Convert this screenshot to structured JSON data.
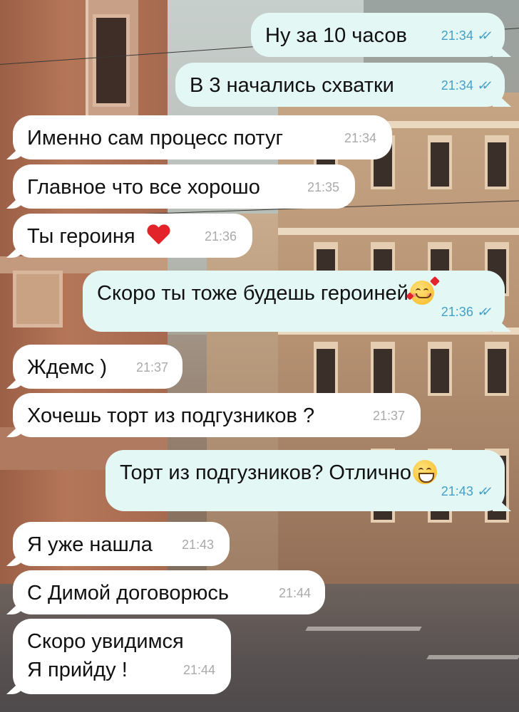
{
  "messages": [
    {
      "dir": "out",
      "text": "Ну за 10 часов",
      "time": "21:34",
      "status": "read"
    },
    {
      "dir": "out",
      "text": "В 3 начались схватки",
      "time": "21:34",
      "status": "read"
    },
    {
      "dir": "in",
      "text": "Именно сам процесс потуг",
      "time": "21:34"
    },
    {
      "dir": "in",
      "text": "Главное что все хорошо",
      "time": "21:35"
    },
    {
      "dir": "in",
      "text": "Ты героиня",
      "time": "21:36",
      "emoji": "red-heart"
    },
    {
      "dir": "out",
      "text": "Скоро ты тоже будешь героиней",
      "time": "21:36",
      "status": "read",
      "emoji": "smiling-face-with-hearts"
    },
    {
      "dir": "in",
      "text": "Ждемс )",
      "time": "21:37"
    },
    {
      "dir": "in",
      "text": "Хочешь торт из подгузников ?",
      "time": "21:37"
    },
    {
      "dir": "out",
      "text": "Торт из подгузников? Отлично",
      "time": "21:43",
      "status": "read",
      "emoji": "grinning-face"
    },
    {
      "dir": "in",
      "text": "Я уже нашла",
      "time": "21:43"
    },
    {
      "dir": "in",
      "text": "С Димой договорюсь",
      "time": "21:44"
    },
    {
      "dir": "in",
      "text": "Скоро увидимся\nЯ прийду !",
      "time": "21:44"
    }
  ],
  "colors": {
    "incoming_bubble": "#ffffff",
    "outgoing_bubble": "#e3f7f4",
    "read_ticks": "#44a0c9",
    "time_incoming": "#aaaaaa"
  },
  "icons": {
    "read": "double-check-icon"
  }
}
